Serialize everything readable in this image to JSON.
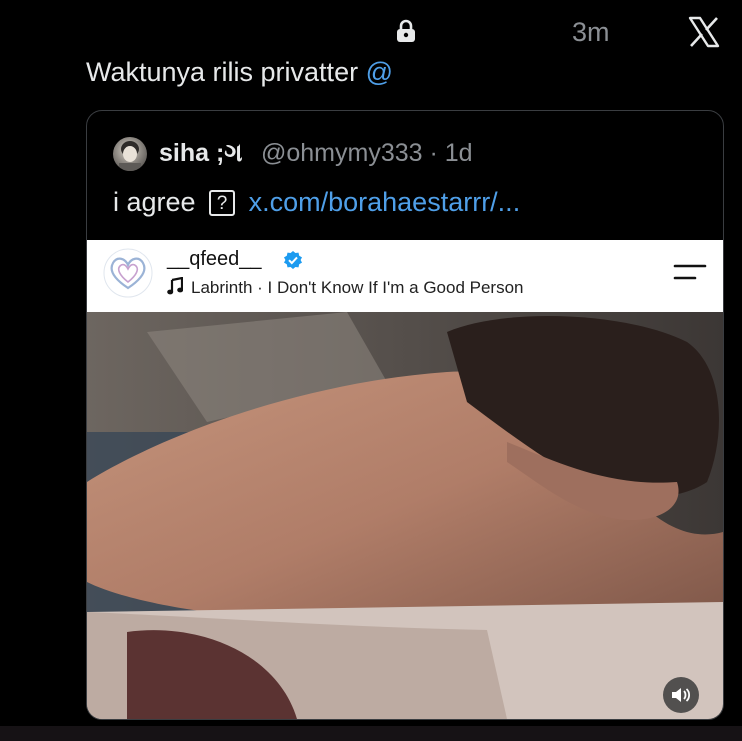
{
  "header": {
    "time": "3m",
    "lock_icon": "lock-icon",
    "app_icon": "x-logo-icon"
  },
  "tweet": {
    "text": "Waktunya rilis privatter ",
    "mention": "@"
  },
  "quote": {
    "display_name": "siha ;ગ",
    "handle_time": "@ohmymy333 · 1d",
    "text": "i agree",
    "emoji_placeholder": "?",
    "link": "x.com/borahaestarrr/..."
  },
  "ig_post": {
    "username": "__qfeed__",
    "music": "Labrinth · I Don't Know If I'm a Good Person",
    "verified_color": "#1d9bf0",
    "menu_icon": "hamburger-menu-icon",
    "sound_icon": "speaker-icon"
  },
  "colors": {
    "link": "#4f9fe8",
    "background": "#000000",
    "secondary_text": "#8b8f94"
  }
}
